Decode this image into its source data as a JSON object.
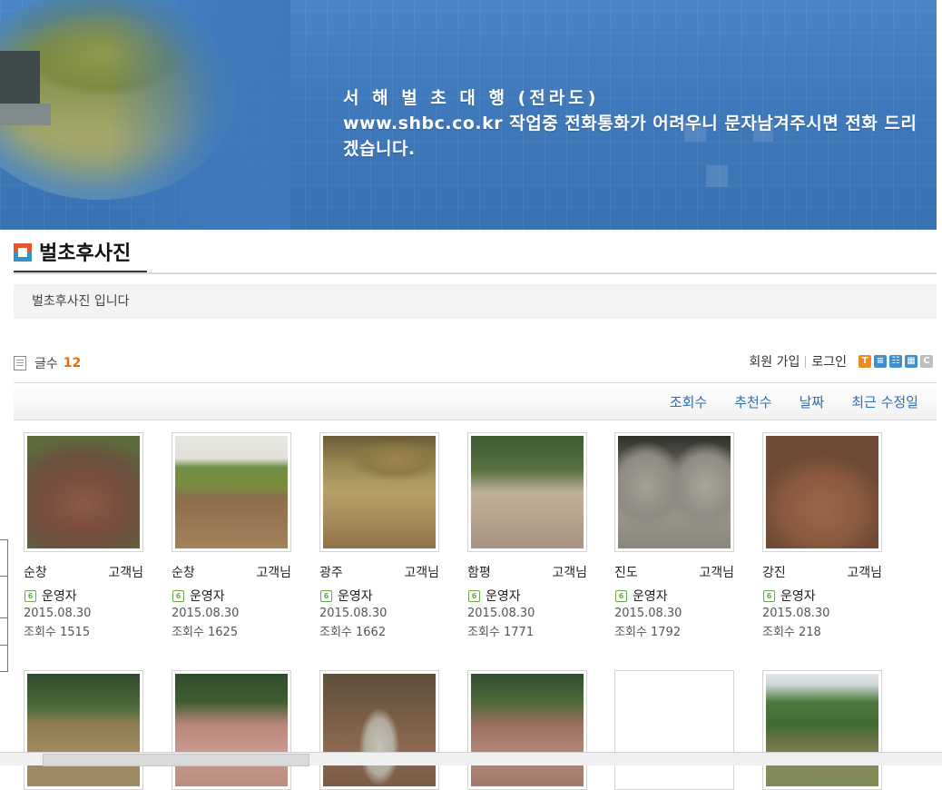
{
  "banner": {
    "line1": "서 해 벌 초 대 행 (전라도)",
    "line2": "www.shbc.co.kr 작업중 전화통화가 어려우니 문자남겨주시면 전화 드리겠습니다."
  },
  "board": {
    "title": "벌초후사진",
    "description": "벌초후사진 입니다",
    "post_count_label": "글수",
    "post_count": "12"
  },
  "account": {
    "join": "회원 가입",
    "login": "로그인"
  },
  "view_icons": [
    {
      "name": "text-view-icon",
      "glyph": "T",
      "color": "#f08a24"
    },
    {
      "name": "list-view-icon",
      "glyph": "≡",
      "color": "#3d8fd1"
    },
    {
      "name": "webzine-view-icon",
      "glyph": "☷",
      "color": "#3d8fd1"
    },
    {
      "name": "gallery-view-icon",
      "glyph": "▦",
      "color": "#3d8fd1"
    },
    {
      "name": "cc-icon",
      "glyph": "C",
      "color": "#bdbdbd"
    }
  ],
  "sort": {
    "views": "조회수",
    "recommends": "추천수",
    "date": "날짜",
    "modified": "최근 수정일"
  },
  "posts": [
    {
      "title": "순창",
      "suffix": "고객님",
      "author": "운영자",
      "date": "2015.08.30",
      "views": "조회수 1515",
      "level": "6"
    },
    {
      "title": "순창",
      "suffix": "고객님",
      "author": "운영자",
      "date": "2015.08.30",
      "views": "조회수 1625",
      "level": "6"
    },
    {
      "title": "광주",
      "suffix": "고객님",
      "author": "운영자",
      "date": "2015.08.30",
      "views": "조회수 1662",
      "level": "6"
    },
    {
      "title": "함평",
      "suffix": "고객님",
      "author": "운영자",
      "date": "2015.08.30",
      "views": "조회수 1771",
      "level": "6"
    },
    {
      "title": "진도",
      "suffix": "고객님",
      "author": "운영자",
      "date": "2015.08.30",
      "views": "조회수 1792",
      "level": "6"
    },
    {
      "title": "강진",
      "suffix": "고객님",
      "author": "운영자",
      "date": "2015.08.30",
      "views": "조회수 218",
      "level": "6"
    }
  ]
}
